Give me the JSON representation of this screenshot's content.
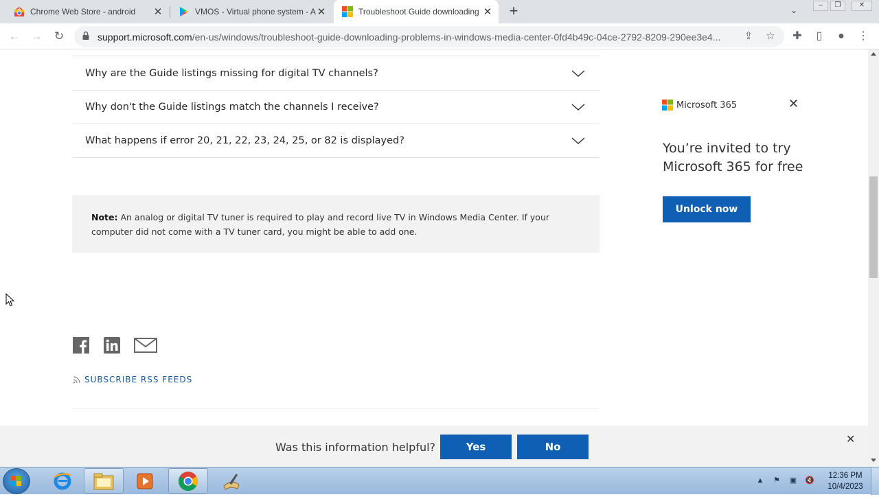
{
  "tabs": [
    {
      "title": "Chrome Web Store - android",
      "favicon": "chrome-web-store-icon",
      "active": false
    },
    {
      "title": "VMOS - Virtual phone system - A",
      "favicon": "google-play-icon",
      "active": false
    },
    {
      "title": "Troubleshoot Guide downloading",
      "favicon": "microsoft-icon",
      "active": true
    }
  ],
  "address_bar": {
    "host": "support.microsoft.com",
    "path": "/en-us/windows/troubleshoot-guide-downloading-problems-in-windows-media-center-0fd4b49c-04ce-2792-8209-290ee3e4..."
  },
  "faqs": [
    "Why are the Guide listings missing for digital TV channels?",
    "Why don't the Guide listings match the channels I receive?",
    "What happens if error 20, 21, 22, 23, 24, 25, or 82 is displayed?"
  ],
  "note": {
    "label": "Note:",
    "text": " An analog or digital TV tuner is required to play and record live TV in Windows Media Center. If your computer did not come with a TV tuner card, you might be able to add one."
  },
  "share_icons": [
    "facebook-icon",
    "linkedin-icon",
    "email-icon"
  ],
  "rss_label": "SUBSCRIBE RSS FEEDS",
  "ad": {
    "brand": "Microsoft 365",
    "headline": "You’re invited to try Microsoft 365 for free",
    "button": "Unlock now"
  },
  "feedback": {
    "question": "Was this information helpful?",
    "yes": "Yes",
    "no": "No"
  },
  "clock": {
    "time": "12:36 PM",
    "date": "10/4/2023"
  },
  "colors": {
    "accent": "#0f5fb4",
    "link": "#1a5a96"
  }
}
